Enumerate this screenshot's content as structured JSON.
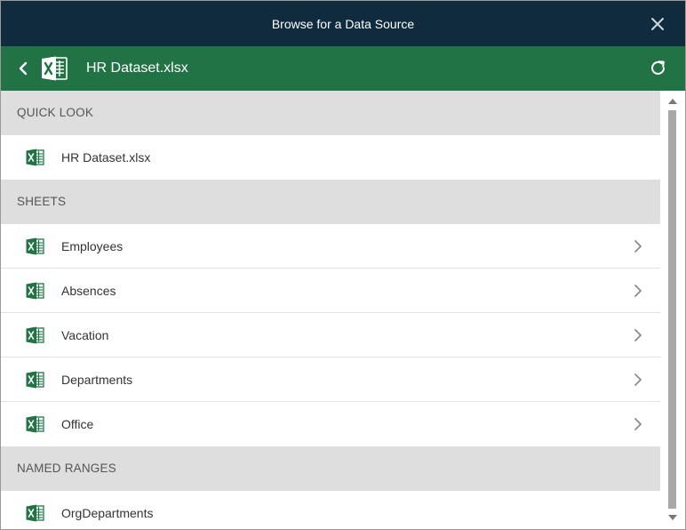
{
  "window": {
    "title": "Browse for a Data Source"
  },
  "navbar": {
    "title": "HR Dataset.xlsx"
  },
  "colors": {
    "titlebar": "#0f2b3d",
    "accent": "#217346",
    "section_bg": "#dedede"
  },
  "sections": {
    "quick_look": {
      "label": "QUICK LOOK",
      "items": [
        {
          "label": "HR Dataset.xlsx",
          "icon": "excel-icon"
        }
      ]
    },
    "sheets": {
      "label": "SHEETS",
      "items": [
        {
          "label": "Employees",
          "icon": "excel-icon"
        },
        {
          "label": "Absences",
          "icon": "excel-icon"
        },
        {
          "label": "Vacation",
          "icon": "excel-icon"
        },
        {
          "label": "Departments",
          "icon": "excel-icon"
        },
        {
          "label": "Office",
          "icon": "excel-icon"
        }
      ]
    },
    "named_ranges": {
      "label": "NAMED RANGES",
      "items": [
        {
          "label": "OrgDepartments",
          "icon": "excel-icon"
        }
      ]
    }
  }
}
